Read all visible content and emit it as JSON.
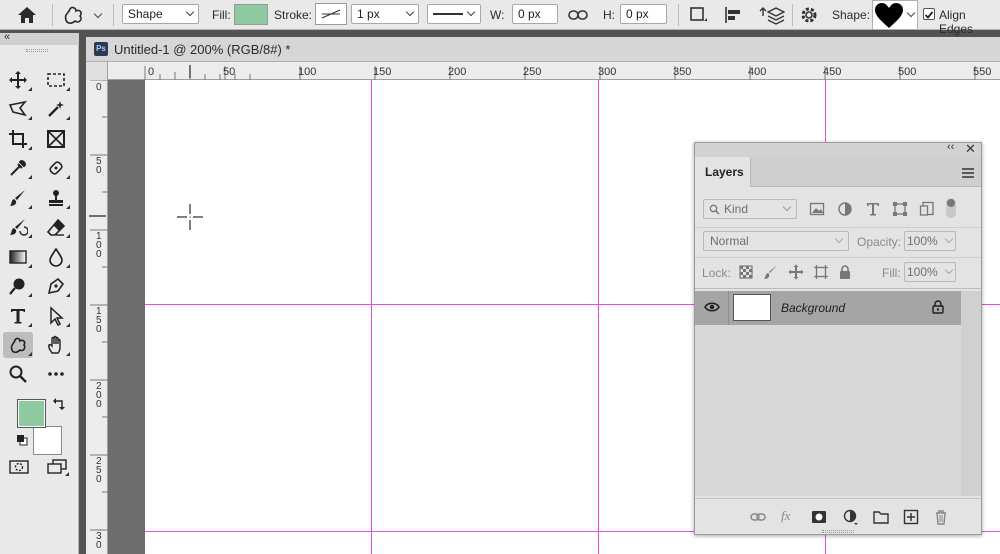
{
  "options_bar": {
    "mode_select": "Shape",
    "fill_label": "Fill:",
    "fill_color": "#8ec9a1",
    "stroke_label": "Stroke:",
    "stroke_width": "1 px",
    "w_label": "W:",
    "w_value": "0 px",
    "h_label": "H:",
    "h_value": "0 px",
    "shape_label": "Shape:",
    "align_edges_label": "Align Edges",
    "align_edges_checked": true
  },
  "document": {
    "title": "Untitled-1 @ 200% (RGB/8#) *",
    "ps_badge": "Ps",
    "ruler_top_labels": [
      "0",
      "50",
      "100",
      "150",
      "200",
      "250",
      "300",
      "350",
      "400",
      "450",
      "500",
      "550"
    ],
    "ruler_left_labels": [
      "0",
      "5\n0",
      "1\n0\n0",
      "1\n5\n0",
      "2\n0\n0",
      "2\n5\n0",
      "3\n0"
    ]
  },
  "toolbar": {
    "foreground_color": "#8ec9a1",
    "background_color": "#ffffff"
  },
  "layers_panel": {
    "tab": "Layers",
    "filter_kind": "Kind",
    "blend_mode": "Normal",
    "opacity_label": "Opacity:",
    "opacity_value": "100%",
    "lock_label": "Lock:",
    "fill_label": "Fill:",
    "fill_value": "100%",
    "layers": [
      {
        "name": "Background",
        "visible": true,
        "locked": true
      }
    ]
  },
  "colors": {
    "guide": "#e34ce0",
    "ui_bg": "#e9e9e9",
    "pasteboard": "#6d6d6d"
  }
}
